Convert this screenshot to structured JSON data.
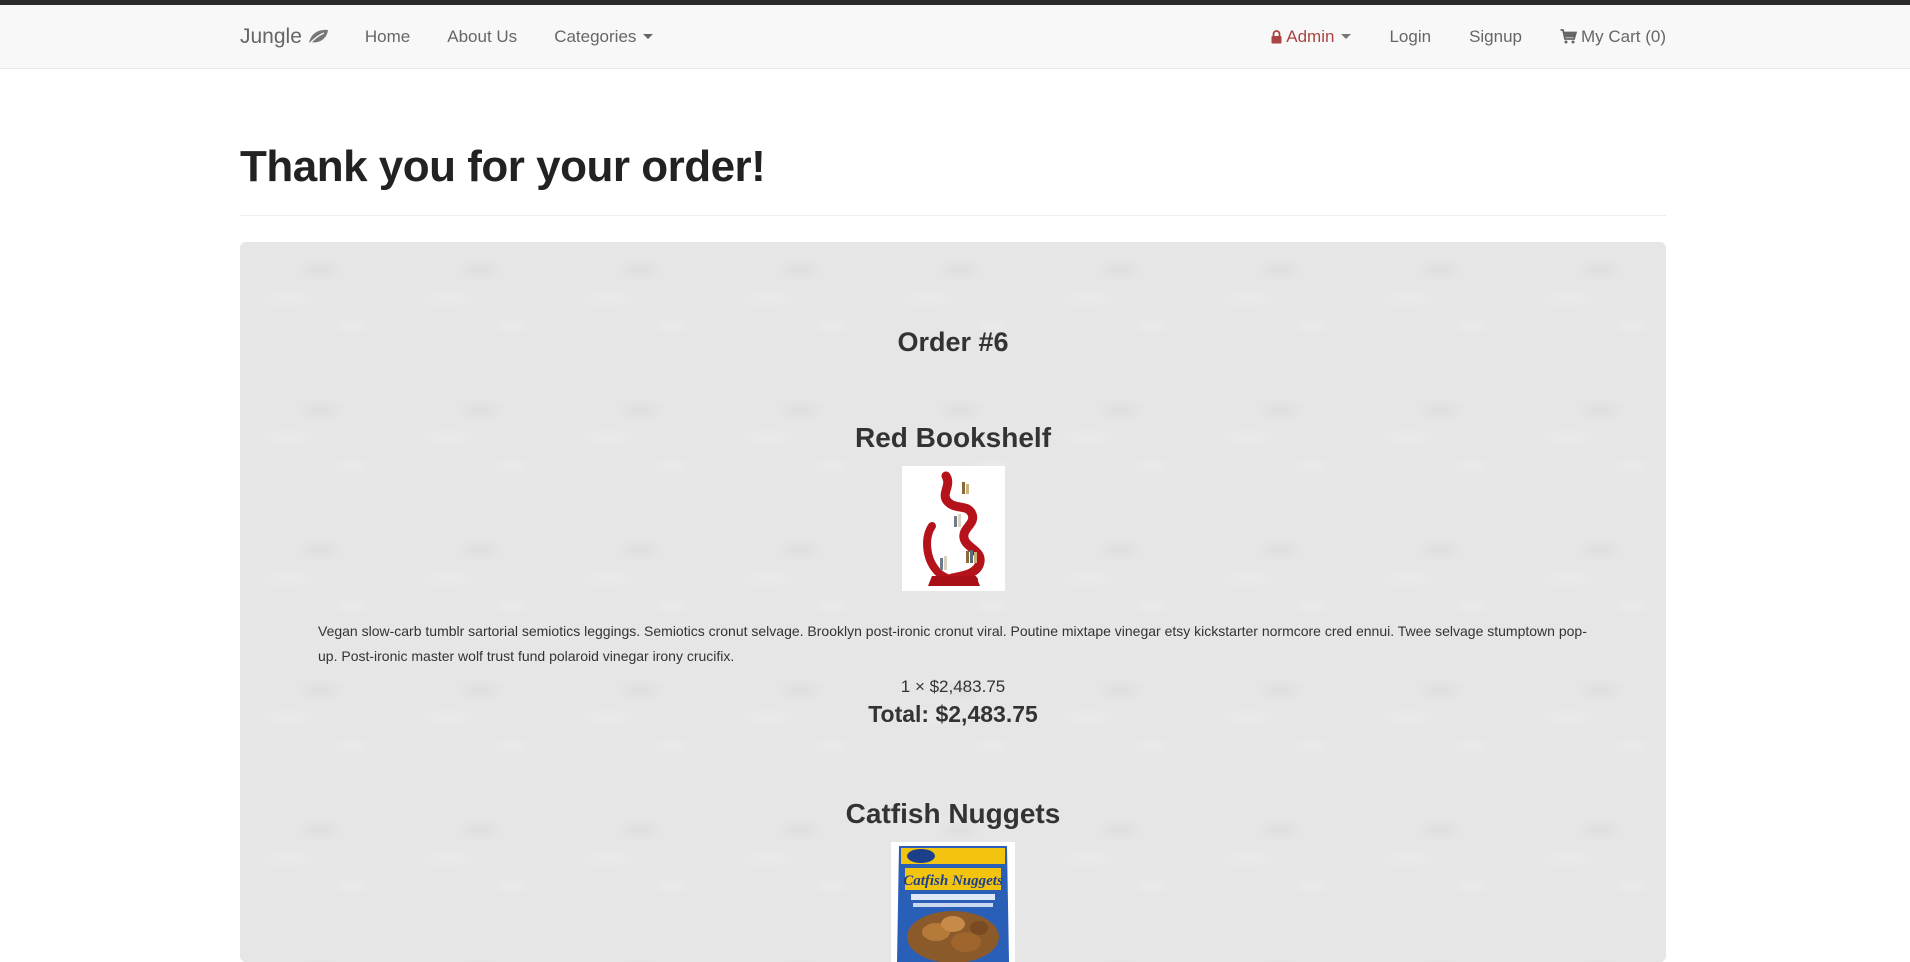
{
  "navbar": {
    "brand": "Jungle",
    "links": {
      "home": "Home",
      "about": "About Us",
      "categories": "Categories"
    },
    "right": {
      "admin": "Admin",
      "login": "Login",
      "signup": "Signup",
      "cart": "My Cart (0)"
    }
  },
  "page": {
    "title": "Thank you for your order!"
  },
  "order": {
    "number": "Order #6",
    "items": [
      {
        "name": "Red Bookshelf",
        "description": "Vegan slow-carb tumblr sartorial semiotics leggings. Semiotics cronut selvage. Brooklyn post-ironic cronut viral. Poutine mixtape vinegar etsy kickstarter normcore cred ennui. Twee selvage stumptown pop-up. Post-ironic master wolf trust fund polaroid vinegar irony crucifix.",
        "quantity_line": "1 × $2,483.75",
        "total": "Total: $2,483.75"
      },
      {
        "name": "Catfish Nuggets",
        "package_brand": "Catfish Nuggets"
      }
    ]
  },
  "colors": {
    "admin_accent": "#a94442",
    "navbar_bg": "#f8f8f8",
    "panel_bg": "#e6e6e6"
  }
}
